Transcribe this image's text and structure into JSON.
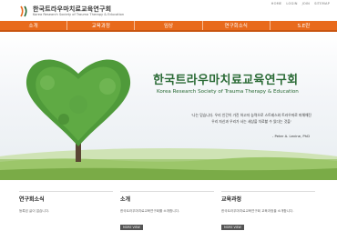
{
  "header": {
    "site_name_ko": "한국트라우마치료교육연구회",
    "site_name_en": "Korea Research Society of Trauma Therapy & Education",
    "util_links": [
      "HOME",
      "LOGIN",
      "JOIN",
      "SITEMAP"
    ]
  },
  "nav": {
    "items": [
      "소개",
      "교육과정",
      "임상",
      "연구회소식",
      "S.E란"
    ]
  },
  "hero": {
    "title": "한국트라우마치료교육연구회",
    "subtitle": "Korea Research Society of Trauma Therapy & Education",
    "quote_lines": [
      "'나는 믿습니다. 우리 인간이 가진 하고자 능력으로 스트레스와 트라우마로 피해해진",
      "우리 자신과 우리가 사는 세상을 치료할 수 있다는 것을'"
    ],
    "author": "- Peter A. Levine, PhD"
  },
  "sections": [
    {
      "title": "연구회소식",
      "body": "등록된 글이 없습니다.",
      "more": ""
    },
    {
      "title": "소개",
      "body": "한국트라우마치료교육연구회를 소개합니다.",
      "more": "MORE VIEW"
    },
    {
      "title": "교육과정",
      "body": "한국트라우마치료교육연구회 교육과정을 소개합니다.",
      "more": "MORE VIEW"
    }
  ],
  "colors": {
    "nav": "#e86a1c",
    "title_green": "#2a6a35"
  }
}
